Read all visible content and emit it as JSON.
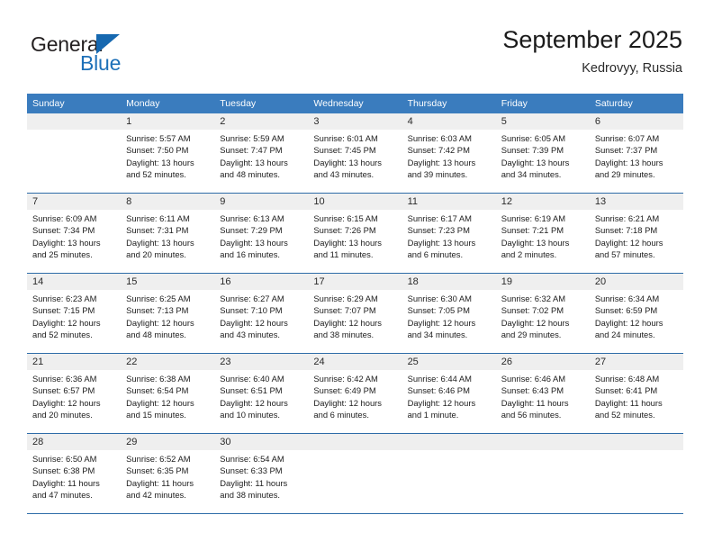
{
  "brand": {
    "name_part1": "General",
    "name_part2": "Blue",
    "triangle_color": "#1668b0",
    "blue_color": "#1d70b8"
  },
  "header": {
    "title": "September 2025",
    "subtitle": "Kedrovyy, Russia"
  },
  "theme": {
    "header_row_bg": "#3a7cbe",
    "week_divider": "#2e6ca8",
    "day_number_bg": "#efefef"
  },
  "weekdays": [
    "Sunday",
    "Monday",
    "Tuesday",
    "Wednesday",
    "Thursday",
    "Friday",
    "Saturday"
  ],
  "weeks": [
    [
      {
        "day": "",
        "blank": true,
        "lines": []
      },
      {
        "day": "1",
        "lines": [
          "Sunrise: 5:57 AM",
          "Sunset: 7:50 PM",
          "Daylight: 13 hours",
          "and 52 minutes."
        ]
      },
      {
        "day": "2",
        "lines": [
          "Sunrise: 5:59 AM",
          "Sunset: 7:47 PM",
          "Daylight: 13 hours",
          "and 48 minutes."
        ]
      },
      {
        "day": "3",
        "lines": [
          "Sunrise: 6:01 AM",
          "Sunset: 7:45 PM",
          "Daylight: 13 hours",
          "and 43 minutes."
        ]
      },
      {
        "day": "4",
        "lines": [
          "Sunrise: 6:03 AM",
          "Sunset: 7:42 PM",
          "Daylight: 13 hours",
          "and 39 minutes."
        ]
      },
      {
        "day": "5",
        "lines": [
          "Sunrise: 6:05 AM",
          "Sunset: 7:39 PM",
          "Daylight: 13 hours",
          "and 34 minutes."
        ]
      },
      {
        "day": "6",
        "lines": [
          "Sunrise: 6:07 AM",
          "Sunset: 7:37 PM",
          "Daylight: 13 hours",
          "and 29 minutes."
        ]
      }
    ],
    [
      {
        "day": "7",
        "lines": [
          "Sunrise: 6:09 AM",
          "Sunset: 7:34 PM",
          "Daylight: 13 hours",
          "and 25 minutes."
        ]
      },
      {
        "day": "8",
        "lines": [
          "Sunrise: 6:11 AM",
          "Sunset: 7:31 PM",
          "Daylight: 13 hours",
          "and 20 minutes."
        ]
      },
      {
        "day": "9",
        "lines": [
          "Sunrise: 6:13 AM",
          "Sunset: 7:29 PM",
          "Daylight: 13 hours",
          "and 16 minutes."
        ]
      },
      {
        "day": "10",
        "lines": [
          "Sunrise: 6:15 AM",
          "Sunset: 7:26 PM",
          "Daylight: 13 hours",
          "and 11 minutes."
        ]
      },
      {
        "day": "11",
        "lines": [
          "Sunrise: 6:17 AM",
          "Sunset: 7:23 PM",
          "Daylight: 13 hours",
          "and 6 minutes."
        ]
      },
      {
        "day": "12",
        "lines": [
          "Sunrise: 6:19 AM",
          "Sunset: 7:21 PM",
          "Daylight: 13 hours",
          "and 2 minutes."
        ]
      },
      {
        "day": "13",
        "lines": [
          "Sunrise: 6:21 AM",
          "Sunset: 7:18 PM",
          "Daylight: 12 hours",
          "and 57 minutes."
        ]
      }
    ],
    [
      {
        "day": "14",
        "lines": [
          "Sunrise: 6:23 AM",
          "Sunset: 7:15 PM",
          "Daylight: 12 hours",
          "and 52 minutes."
        ]
      },
      {
        "day": "15",
        "lines": [
          "Sunrise: 6:25 AM",
          "Sunset: 7:13 PM",
          "Daylight: 12 hours",
          "and 48 minutes."
        ]
      },
      {
        "day": "16",
        "lines": [
          "Sunrise: 6:27 AM",
          "Sunset: 7:10 PM",
          "Daylight: 12 hours",
          "and 43 minutes."
        ]
      },
      {
        "day": "17",
        "lines": [
          "Sunrise: 6:29 AM",
          "Sunset: 7:07 PM",
          "Daylight: 12 hours",
          "and 38 minutes."
        ]
      },
      {
        "day": "18",
        "lines": [
          "Sunrise: 6:30 AM",
          "Sunset: 7:05 PM",
          "Daylight: 12 hours",
          "and 34 minutes."
        ]
      },
      {
        "day": "19",
        "lines": [
          "Sunrise: 6:32 AM",
          "Sunset: 7:02 PM",
          "Daylight: 12 hours",
          "and 29 minutes."
        ]
      },
      {
        "day": "20",
        "lines": [
          "Sunrise: 6:34 AM",
          "Sunset: 6:59 PM",
          "Daylight: 12 hours",
          "and 24 minutes."
        ]
      }
    ],
    [
      {
        "day": "21",
        "lines": [
          "Sunrise: 6:36 AM",
          "Sunset: 6:57 PM",
          "Daylight: 12 hours",
          "and 20 minutes."
        ]
      },
      {
        "day": "22",
        "lines": [
          "Sunrise: 6:38 AM",
          "Sunset: 6:54 PM",
          "Daylight: 12 hours",
          "and 15 minutes."
        ]
      },
      {
        "day": "23",
        "lines": [
          "Sunrise: 6:40 AM",
          "Sunset: 6:51 PM",
          "Daylight: 12 hours",
          "and 10 minutes."
        ]
      },
      {
        "day": "24",
        "lines": [
          "Sunrise: 6:42 AM",
          "Sunset: 6:49 PM",
          "Daylight: 12 hours",
          "and 6 minutes."
        ]
      },
      {
        "day": "25",
        "lines": [
          "Sunrise: 6:44 AM",
          "Sunset: 6:46 PM",
          "Daylight: 12 hours",
          "and 1 minute."
        ]
      },
      {
        "day": "26",
        "lines": [
          "Sunrise: 6:46 AM",
          "Sunset: 6:43 PM",
          "Daylight: 11 hours",
          "and 56 minutes."
        ]
      },
      {
        "day": "27",
        "lines": [
          "Sunrise: 6:48 AM",
          "Sunset: 6:41 PM",
          "Daylight: 11 hours",
          "and 52 minutes."
        ]
      }
    ],
    [
      {
        "day": "28",
        "lines": [
          "Sunrise: 6:50 AM",
          "Sunset: 6:38 PM",
          "Daylight: 11 hours",
          "and 47 minutes."
        ]
      },
      {
        "day": "29",
        "lines": [
          "Sunrise: 6:52 AM",
          "Sunset: 6:35 PM",
          "Daylight: 11 hours",
          "and 42 minutes."
        ]
      },
      {
        "day": "30",
        "lines": [
          "Sunrise: 6:54 AM",
          "Sunset: 6:33 PM",
          "Daylight: 11 hours",
          "and 38 minutes."
        ]
      },
      {
        "day": "",
        "blank": true,
        "lines": []
      },
      {
        "day": "",
        "blank": true,
        "lines": []
      },
      {
        "day": "",
        "blank": true,
        "lines": []
      },
      {
        "day": "",
        "blank": true,
        "lines": []
      }
    ]
  ]
}
